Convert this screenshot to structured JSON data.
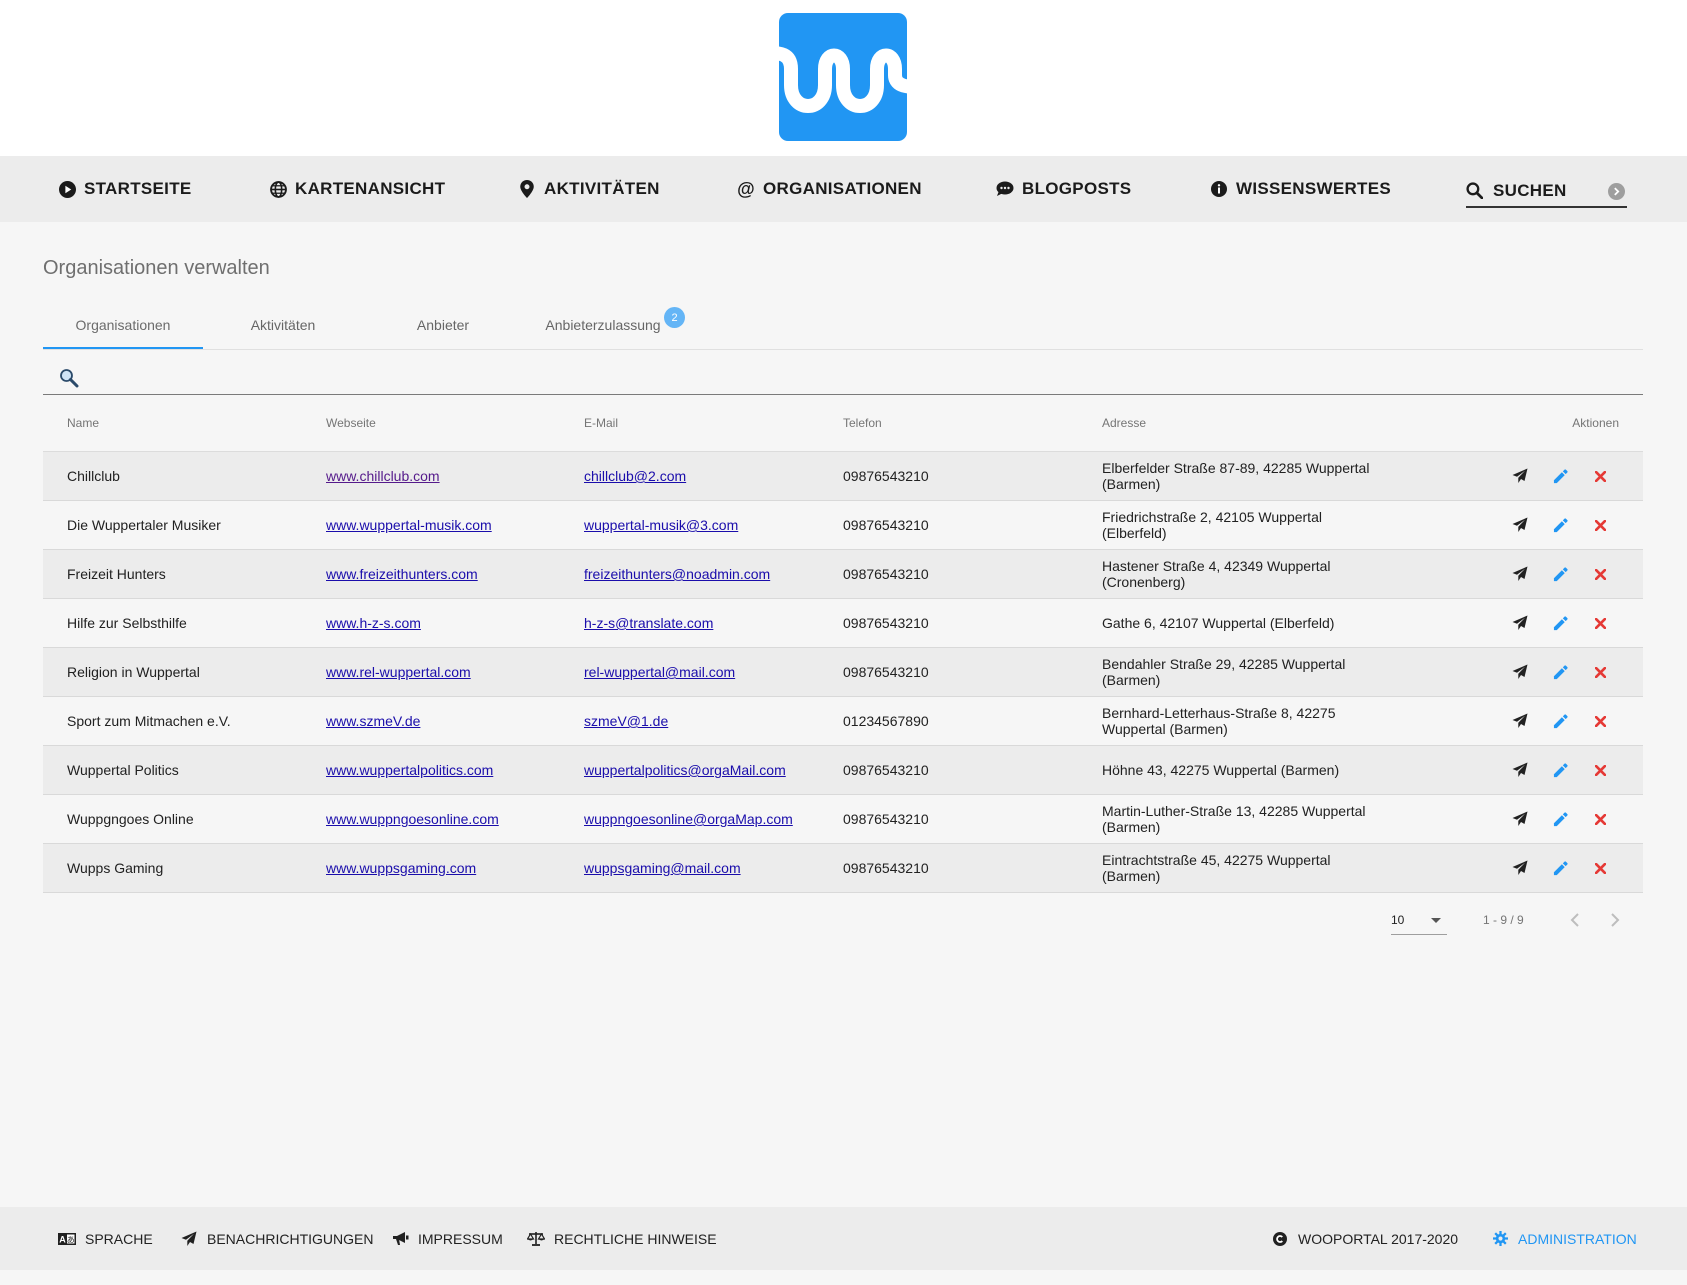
{
  "brand": {
    "logo": "wooportal-logo",
    "accent": "#2196f3"
  },
  "nav": {
    "items": [
      {
        "label": "STARTSEITE",
        "icon": "play-circle-icon"
      },
      {
        "label": "KARTENANSICHT",
        "icon": "globe-icon"
      },
      {
        "label": "AKTIVITÄTEN",
        "icon": "map-marker-icon"
      },
      {
        "label": "ORGANISATIONEN",
        "icon": "at-icon"
      },
      {
        "label": "BLOGPOSTS",
        "icon": "comment-icon"
      },
      {
        "label": "WISSENSWERTES",
        "icon": "info-circle-icon"
      }
    ],
    "search": {
      "label": "SUCHEN",
      "icon": "search-icon"
    }
  },
  "main": {
    "title": "Organisationen verwalten",
    "tabs": [
      {
        "label": "Organisationen"
      },
      {
        "label": "Aktivitäten"
      },
      {
        "label": "Anbieter"
      },
      {
        "label": "Anbieterzulassung",
        "badge": "2"
      }
    ],
    "filter": {
      "placeholder": ""
    },
    "table": {
      "headers": {
        "name": "Name",
        "website": "Webseite",
        "email": "E-Mail",
        "phone": "Telefon",
        "address": "Adresse",
        "actions": "Aktionen"
      },
      "rows": [
        {
          "name": "Chillclub",
          "website": "www.chillclub.com",
          "email": "chillclub@2.com",
          "phone": "09876543210",
          "address": "Elberfelder Straße 87-89, 42285 Wuppertal (Barmen)"
        },
        {
          "name": "Die Wuppertaler Musiker",
          "website": "www.wuppertal-musik.com",
          "email": "wuppertal-musik@3.com",
          "phone": "09876543210",
          "address": "Friedrichstraße 2, 42105 Wuppertal (Elberfeld)"
        },
        {
          "name": "Freizeit Hunters",
          "website": "www.freizeithunters.com",
          "email": "freizeithunters@noadmin.com",
          "phone": "09876543210",
          "address": "Hastener Straße 4, 42349 Wuppertal (Cronenberg)"
        },
        {
          "name": "Hilfe zur Selbsthilfe",
          "website": "www.h-z-s.com",
          "email": "h-z-s@translate.com",
          "phone": "09876543210",
          "address": "Gathe 6, 42107 Wuppertal (Elberfeld)"
        },
        {
          "name": "Religion in Wuppertal",
          "website": "www.rel-wuppertal.com",
          "email": "rel-wuppertal@mail.com",
          "phone": "09876543210",
          "address": "Bendahler Straße 29, 42285 Wuppertal (Barmen)"
        },
        {
          "name": "Sport zum Mitmachen e.V.",
          "website": "www.szmeV.de",
          "email": "szmeV@1.de",
          "phone": "01234567890",
          "address": "Bernhard-Letterhaus-Straße 8, 42275 Wuppertal (Barmen)"
        },
        {
          "name": "Wuppertal Politics",
          "website": "www.wuppertalpolitics.com",
          "email": "wuppertalpolitics@orgaMail.com",
          "phone": "09876543210",
          "address": "Höhne 43, 42275 Wuppertal (Barmen)"
        },
        {
          "name": "Wuppgngoes Online",
          "website": "www.wuppngoesonline.com",
          "email": "wuppngoesonline@orgaMap.com",
          "phone": "09876543210",
          "address": "Martin-Luther-Straße 13, 42285 Wuppertal (Barmen)"
        },
        {
          "name": "Wupps Gaming",
          "website": "www.wuppsgaming.com",
          "email": "wuppsgaming@mail.com",
          "phone": "09876543210",
          "address": "Eintrachtstraße 45, 42275 Wuppertal (Barmen)"
        }
      ],
      "row_actions": [
        "send-icon",
        "edit-pencil-icon",
        "delete-x-icon"
      ]
    },
    "paginator": {
      "page_size": "10",
      "range": "1 - 9 / 9"
    }
  },
  "footer": {
    "items": [
      {
        "label": "SPRACHE",
        "icon": "language-icon"
      },
      {
        "label": "BENACHRICHTIGUNGEN",
        "icon": "send-icon"
      },
      {
        "label": "IMPRESSUM",
        "icon": "bullhorn-icon"
      },
      {
        "label": "RECHTLICHE HINWEISE",
        "icon": "balance-scale-icon"
      }
    ],
    "copyright": "WOOPORTAL 2017-2020",
    "admin": "ADMINISTRATION"
  },
  "colors": {
    "delete": "#e53935",
    "edit": "#2196f3",
    "send": "#212121",
    "badge": "#64b5f6"
  }
}
